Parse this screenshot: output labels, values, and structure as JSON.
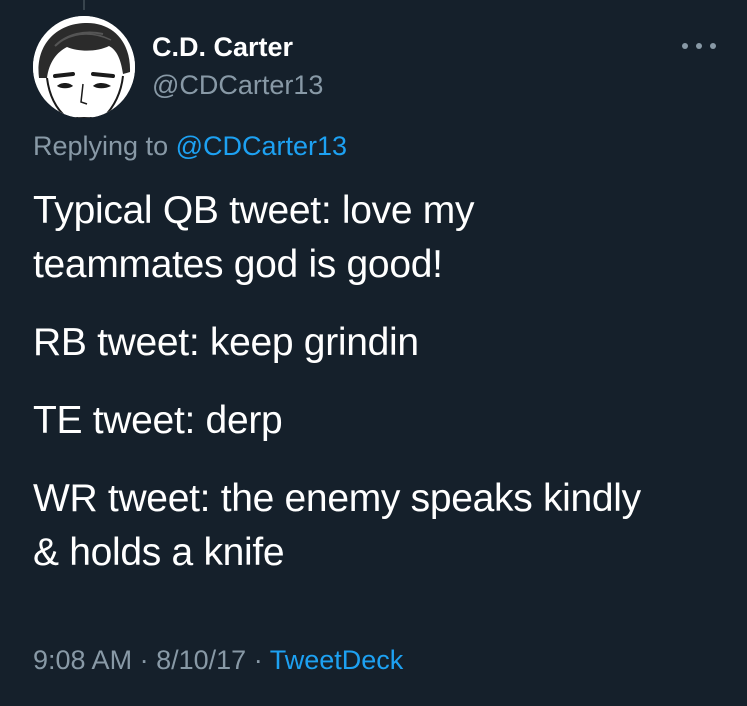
{
  "tweet": {
    "author_name": "C.D. Carter",
    "author_handle": "@CDCarter13",
    "replying_prefix": "Replying to",
    "replying_handle": "@CDCarter13",
    "paragraphs": [
      "Typical QB tweet: love my\nteammates god is good!",
      "RB tweet: keep grindin",
      "TE tweet: derp",
      "WR tweet: the enemy speaks kindly\n& holds a knife"
    ],
    "time": "9:08 AM",
    "separator": "·",
    "date": "8/10/17",
    "source": "TweetDeck"
  },
  "icons": {
    "avatar": "cartoon-face-avatar",
    "more": "more-horizontal-icon"
  },
  "colors": {
    "background": "#15202b",
    "primary_text": "#ffffff",
    "secondary_text": "#8899a6",
    "link": "#1da1f2"
  }
}
